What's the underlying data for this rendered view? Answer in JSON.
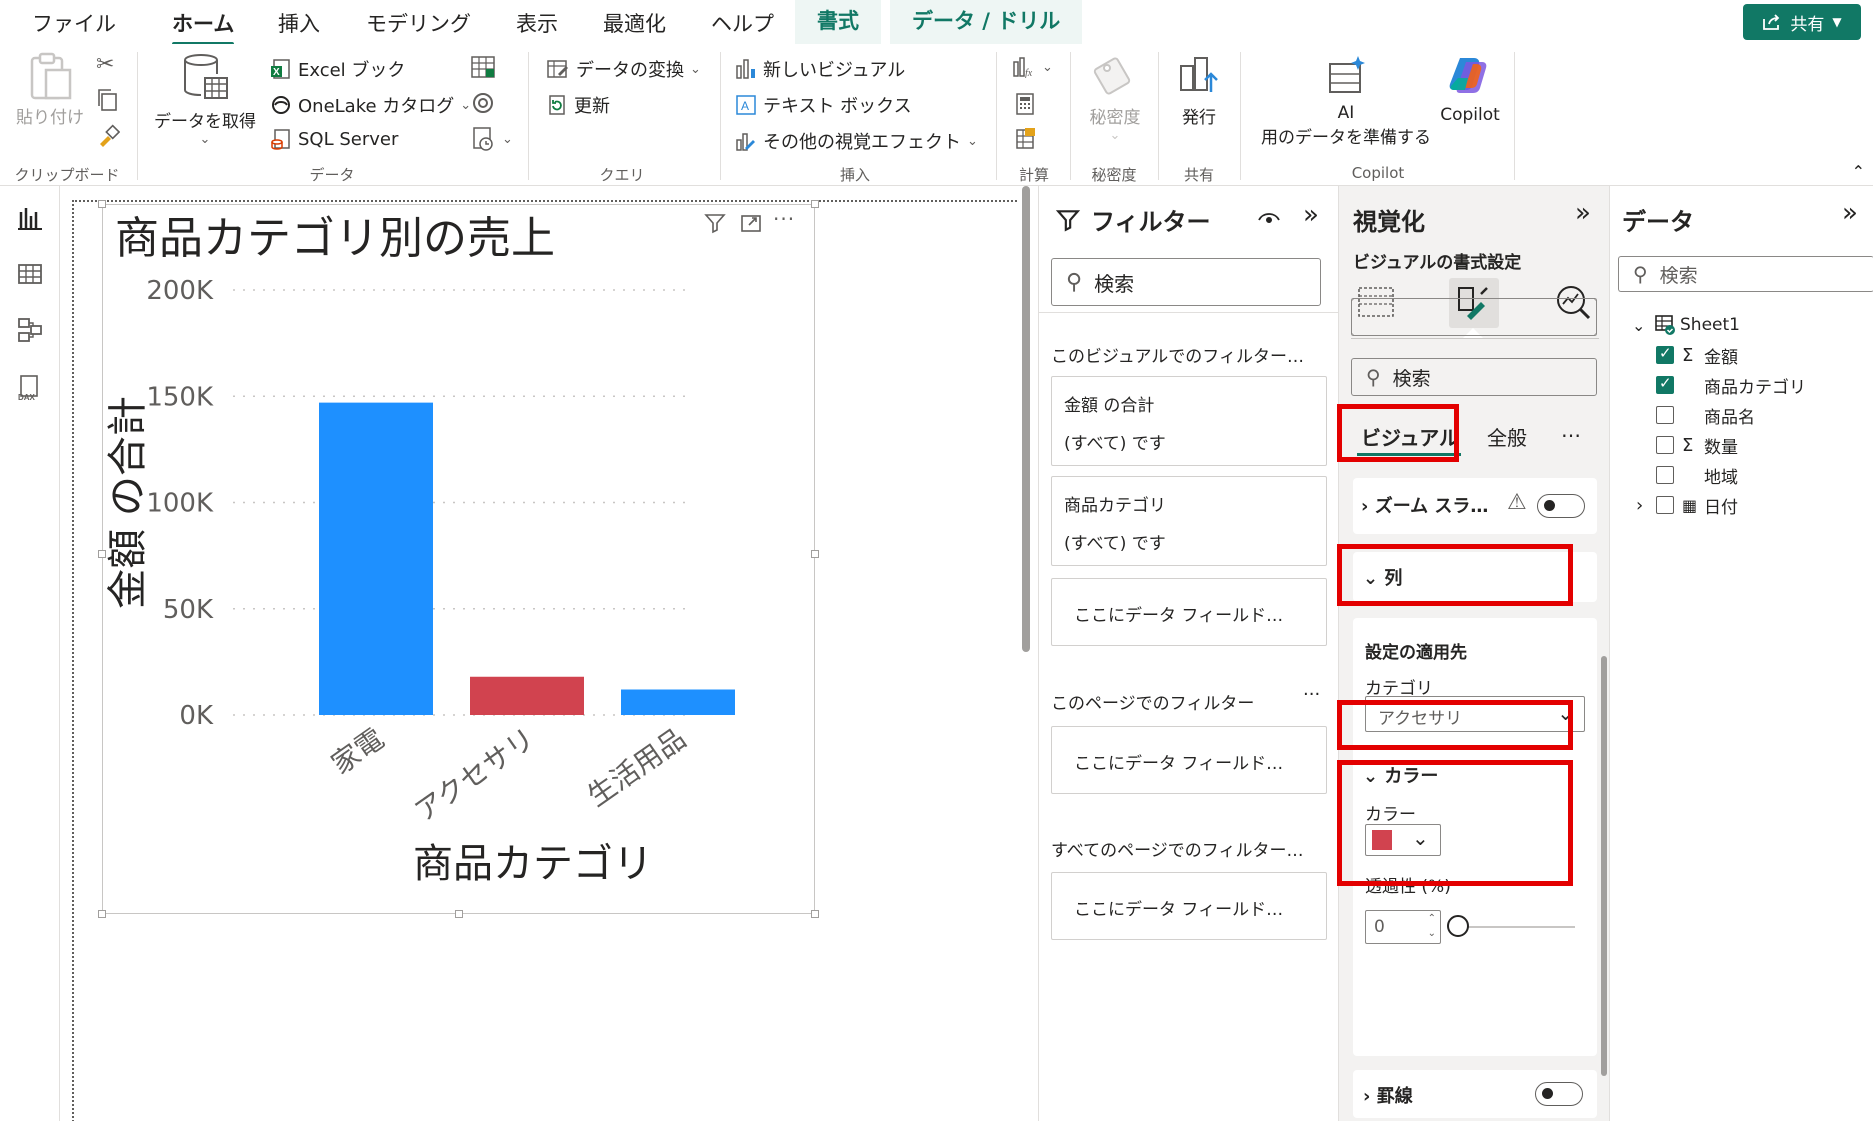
{
  "menu": {
    "tabs": [
      "ファイル",
      "ホーム",
      "挿入",
      "モデリング",
      "表示",
      "最適化",
      "ヘルプ"
    ],
    "contextual_tabs": [
      "書式",
      "データ / ドリル"
    ],
    "share_label": "共有"
  },
  "ribbon": {
    "clipboard": {
      "paste": "貼り付け",
      "group": "クリップボード"
    },
    "data": {
      "get_data": "データを取得",
      "excel": "Excel ブック",
      "onelake": "OneLake カタログ",
      "sql": "SQL Server",
      "group": "データ"
    },
    "query": {
      "transform": "データの変換",
      "refresh": "更新",
      "group": "クエリ"
    },
    "insert": {
      "new_visual": "新しいビジュアル",
      "text_box": "テキスト ボックス",
      "more_visuals": "その他の視覚エフェクト",
      "group": "挿入"
    },
    "calc": {
      "group": "計算"
    },
    "sensitivity": {
      "label": "秘密度",
      "group": "秘密度"
    },
    "share": {
      "publish": "発行",
      "group": "共有"
    },
    "copilot": {
      "ai_line1": "AI",
      "ai_line2": "用のデータを準備する",
      "copilot": "Copilot",
      "group": "Copilot"
    }
  },
  "chart_data": {
    "type": "bar",
    "title": "商品カテゴリ別の売上",
    "xlabel": "商品カテゴリ",
    "ylabel": "金額 の合計",
    "categories": [
      "家電",
      "アクセサリ",
      "生活用品"
    ],
    "values": [
      147000,
      18000,
      12000
    ],
    "bar_colors": [
      "#1e90ff",
      "#d1434f",
      "#1e90ff"
    ],
    "ylim": [
      0,
      200000
    ],
    "yticks": [
      "0K",
      "50K",
      "100K",
      "150K",
      "200K"
    ],
    "grid": true
  },
  "filters": {
    "title": "フィルター",
    "search_placeholder": "検索",
    "visual_section": "このビジュアルでのフィルター…",
    "cards": [
      {
        "field": "金額 の合計",
        "state": "(すべて) です"
      },
      {
        "field": "商品カテゴリ",
        "state": "(すべて) です"
      }
    ],
    "add_field": "ここにデータ フィールド…",
    "page_section": "このページでのフィルター",
    "all_pages_section": "すべてのページでのフィルター…"
  },
  "visualizations": {
    "title": "視覚化",
    "subtitle": "ビジュアルの書式設定",
    "search_placeholder": "検索",
    "tab_visual": "ビジュアル",
    "tab_general": "全般",
    "more": "…",
    "zoom_slider": "ズーム スラ…",
    "columns": "列",
    "apply_settings_to": "設定の適用先",
    "category_label": "カテゴリ",
    "category_value": "アクセサリ",
    "colors_section": "カラー",
    "color_label": "カラー",
    "color_value": "#d1434f",
    "transparency_label": "透過性 (%)",
    "transparency_value": "0",
    "border_section": "罫線"
  },
  "data_pane": {
    "title": "データ",
    "search_placeholder": "検索",
    "table": "Sheet1",
    "fields": [
      {
        "name": "金額",
        "checked": true,
        "sigma": true
      },
      {
        "name": "商品カテゴリ",
        "checked": true,
        "sigma": false
      },
      {
        "name": "商品名",
        "checked": false,
        "sigma": false
      },
      {
        "name": "数量",
        "checked": false,
        "sigma": true
      },
      {
        "name": "地域",
        "checked": false,
        "sigma": false
      },
      {
        "name": "日付",
        "checked": false,
        "sigma": false,
        "expandable": true
      }
    ]
  }
}
